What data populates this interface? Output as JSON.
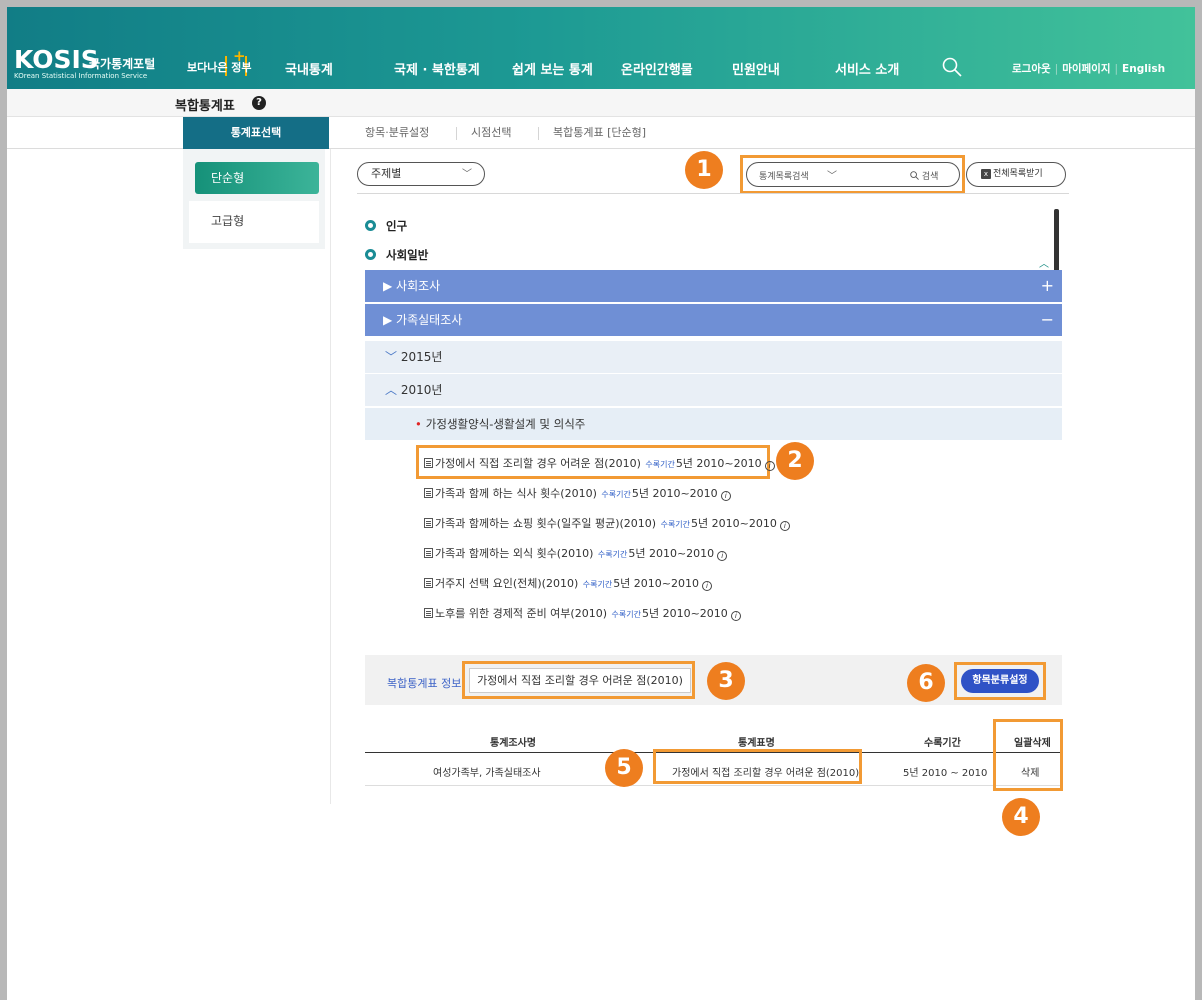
{
  "header": {
    "logo": "KOSIS",
    "logo_kr": "국가통계포털",
    "logo_sub": "KOrean Statistical Information Service",
    "badge": "보다나은 정부",
    "nav": [
      "국내통계",
      "국제 · 북한통계",
      "쉽게 보는 통계",
      "온라인간행물",
      "민원안내",
      "서비스 소개"
    ],
    "util": [
      "로그아웃",
      "마이페이지",
      "English"
    ]
  },
  "page": {
    "title": "복합통계표",
    "help": "?"
  },
  "steps": {
    "active": "통계표선택",
    "others": [
      "항목·분류설정",
      "시점선택",
      "복합통계표 [단순형]"
    ]
  },
  "side": {
    "simple": "단순형",
    "advanced": "고급형"
  },
  "filters": {
    "topic": "주제별",
    "search_scope": "통계목록검색",
    "search_button": "검색",
    "download": "전체목록받기"
  },
  "tree": {
    "nodes": [
      "인구",
      "사회일반"
    ],
    "bars": [
      {
        "label": "사회조사",
        "symbol": "+"
      },
      {
        "label": "가족실태조사",
        "symbol": "−"
      }
    ],
    "years": [
      "2015년",
      "2010년"
    ],
    "subgroup": "가정생활양식-생활설계 및 의식주",
    "period_label": "수록기간",
    "items": [
      {
        "title": "가정에서 직접 조리할 경우 어려운 점(2010)",
        "period": "5년 2010~2010"
      },
      {
        "title": "가족과 함께 하는 식사 횟수(2010)",
        "period": "5년 2010~2010"
      },
      {
        "title": "가족과 함께하는 쇼핑 횟수(일주일 평균)(2010)",
        "period": "5년 2010~2010"
      },
      {
        "title": "가족과 함께하는 외식 횟수(2010)",
        "period": "5년 2010~2010"
      },
      {
        "title": "거주지 선택 요인(전체)(2010)",
        "period": "5년 2010~2010"
      },
      {
        "title": "노후를 위한 경제적 준비 여부(2010)",
        "period": "5년 2010~2010"
      }
    ]
  },
  "info": {
    "label": "복합통계표 정보",
    "value": "가정에서 직접 조리할 경우 어려운 점(2010)",
    "button": "항목분류설정"
  },
  "table": {
    "headers": [
      "통계조사명",
      "통계표명",
      "수록기간",
      "일괄삭제"
    ],
    "row": {
      "survey": "여성가족부, 가족실태조사",
      "table": "가정에서 직접 조리할 경우 어려운 점(2010)",
      "period": "5년 2010 ~ 2010",
      "action": "삭제"
    }
  },
  "annotations": [
    "1",
    "2",
    "3",
    "4",
    "5",
    "6"
  ],
  "colors": {
    "accent_orange": "#f29a34",
    "badge_orange": "#ee7e1f",
    "header_teal": "#1d9a94",
    "bar_blue": "#6f8fd5",
    "button_blue": "#2f52c6"
  }
}
